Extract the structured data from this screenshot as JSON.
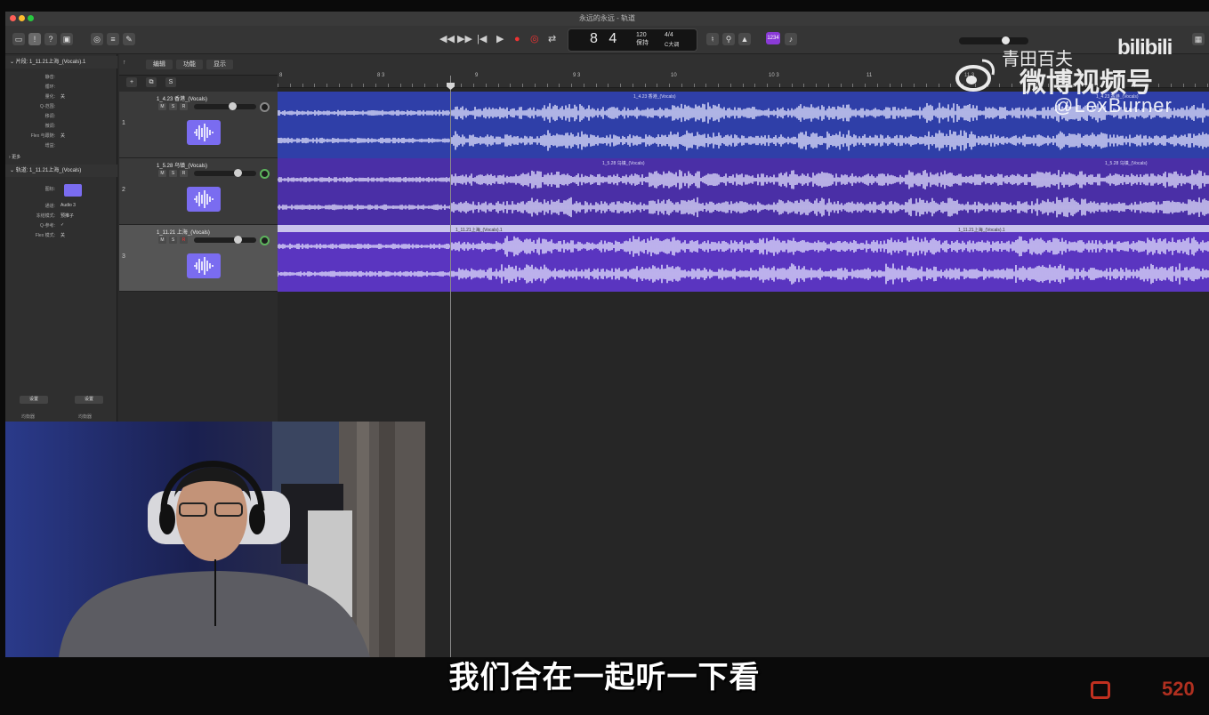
{
  "window": {
    "title": "永远的永远 - 轨道",
    "colors": {
      "region_blue": "#2f3fa8",
      "region_purple": "#4a2fa6",
      "region_violet": "#5a35c0",
      "wave": "#ffffff",
      "record_red": "#e33333",
      "pan_green": "#5db45d"
    }
  },
  "toolbar": {
    "transport": [
      "◀◀",
      "▶▶",
      "|◀",
      "▶",
      "●",
      "◎",
      "⇄"
    ],
    "lcd": {
      "position": "8 4",
      "tempo": "120",
      "tempo_sub": "保持",
      "signature": "4/4",
      "key": "C大调"
    },
    "badge": "1234"
  },
  "inspector": {
    "region_header": "片段: 1_11.21上海_(Vocals).1",
    "region_rows": [
      {
        "k": "静音:",
        "v": ""
      },
      {
        "k": "循环:",
        "v": ""
      },
      {
        "k": "量化:",
        "v": "关"
      },
      {
        "k": "Q-范围:",
        "v": ""
      },
      {
        "k": "移调:",
        "v": ""
      },
      {
        "k": "微调:",
        "v": ""
      },
      {
        "k": "Flex 与跟随:",
        "v": "关"
      },
      {
        "k": "增益:",
        "v": ""
      }
    ],
    "more": "更多",
    "track_header": "轨道: 1_11.21上海_(Vocals)",
    "track_rows": [
      {
        "k": "图标:",
        "v": ""
      },
      {
        "k": "通道:",
        "v": "Audio 3"
      },
      {
        "k": "冻结模式:",
        "v": "预推子"
      },
      {
        "k": "Q-参考:",
        "v": "✓"
      },
      {
        "k": "Flex 模式:",
        "v": "关"
      }
    ],
    "bottom_buttons": [
      "设置",
      "设置"
    ],
    "bottom_labels": [
      "均衡器",
      "均衡器"
    ]
  },
  "track_toolbar": {
    "menus": [
      "编辑",
      "功能",
      "显示"
    ],
    "buttons": [
      "+",
      "⧉",
      "S"
    ]
  },
  "tracks": [
    {
      "number": "1",
      "name": "1_4.23 香港_(Vocals)",
      "region": "1_4.23 香港_(Vocals)",
      "fader_pct": 62
    },
    {
      "number": "2",
      "name": "1_5.28 乌镇_(Vocals)",
      "region": "1_5.28 乌镇_(Vocals)",
      "fader_pct": 70
    },
    {
      "number": "3",
      "name": "1_11.21 上海_(Vocals)",
      "region": "1_11.21上海_(Vocals).1",
      "fader_pct": 70
    }
  ],
  "ruler": {
    "labels": [
      "8",
      "8 3",
      "9",
      "9 3",
      "10",
      "10 3",
      "11",
      "11 3"
    ]
  },
  "watermarks": {
    "weibo": "微博视频号",
    "handle": "@LexBurner",
    "bili": "bilibili",
    "top_line": "青田百夫"
  },
  "caption": "我们合在一起听一下看",
  "corner_logo": "520"
}
